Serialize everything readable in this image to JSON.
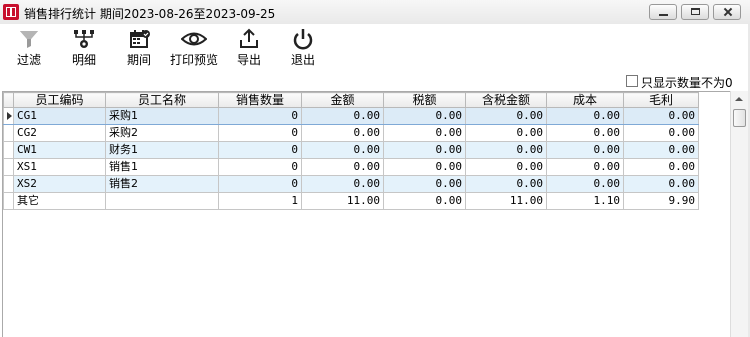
{
  "window": {
    "title": "销售排行统计 期间2023-08-26至2023-09-25"
  },
  "toolbar": {
    "buttons": [
      {
        "label": "过滤",
        "icon": "filter-icon"
      },
      {
        "label": "明细",
        "icon": "hierarchy-icon"
      },
      {
        "label": "期间",
        "icon": "calendar-icon"
      },
      {
        "label": "打印预览",
        "icon": "eye-icon"
      },
      {
        "label": "导出",
        "icon": "export-icon"
      },
      {
        "label": "退出",
        "icon": "power-icon"
      }
    ]
  },
  "options": {
    "show_nonzero_label": "只显示数量不为0",
    "show_nonzero_checked": false
  },
  "table": {
    "columns": [
      "员工编码",
      "员工名称",
      "销售数量",
      "金额",
      "税额",
      "含税金额",
      "成本",
      "毛利"
    ],
    "rows": [
      [
        "CG1",
        "采购1",
        "0",
        "0.00",
        "0.00",
        "0.00",
        "0.00",
        "0.00"
      ],
      [
        "CG2",
        "采购2",
        "0",
        "0.00",
        "0.00",
        "0.00",
        "0.00",
        "0.00"
      ],
      [
        "CW1",
        "财务1",
        "0",
        "0.00",
        "0.00",
        "0.00",
        "0.00",
        "0.00"
      ],
      [
        "XS1",
        "销售1",
        "0",
        "0.00",
        "0.00",
        "0.00",
        "0.00",
        "0.00"
      ],
      [
        "XS2",
        "销售2",
        "0",
        "0.00",
        "0.00",
        "0.00",
        "0.00",
        "0.00"
      ],
      [
        "其它",
        "",
        "1",
        "11.00",
        "0.00",
        "11.00",
        "1.10",
        "9.90"
      ]
    ]
  }
}
